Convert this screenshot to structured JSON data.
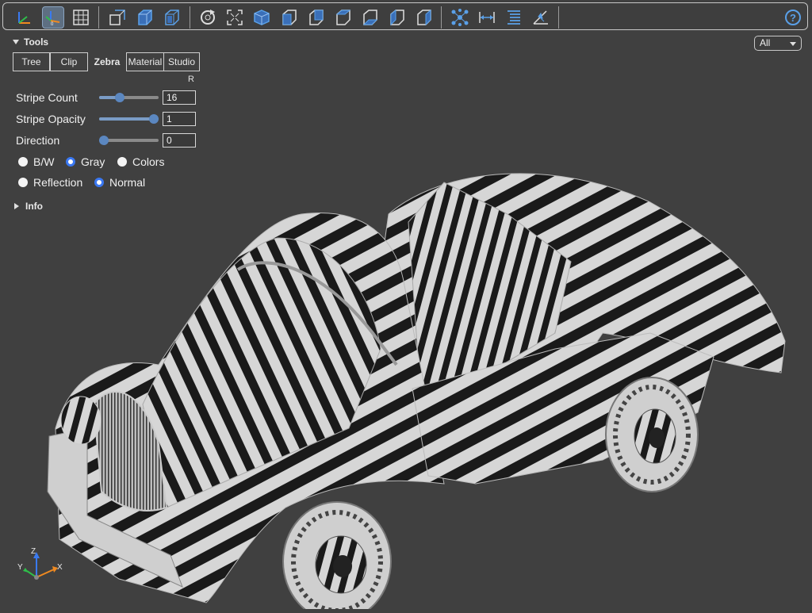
{
  "toolbar": {
    "buttons": [
      {
        "icon": "axes-icon",
        "active": false
      },
      {
        "icon": "axes-origin-icon",
        "active": true
      },
      {
        "icon": "grid-icon",
        "active": false
      },
      {
        "icon": "perspective-icon",
        "active": false
      },
      {
        "icon": "shaded-cube-icon",
        "active": false
      },
      {
        "icon": "wireframe-cube-icon",
        "active": false
      },
      {
        "icon": "reset-view-icon",
        "active": false
      },
      {
        "icon": "fit-view-icon",
        "active": false
      },
      {
        "icon": "iso-view-icon",
        "active": false
      },
      {
        "icon": "front-view-icon",
        "active": false
      },
      {
        "icon": "rear-view-icon",
        "active": false
      },
      {
        "icon": "top-view-icon",
        "active": false
      },
      {
        "icon": "bottom-view-icon",
        "active": false
      },
      {
        "icon": "left-view-icon",
        "active": false
      },
      {
        "icon": "right-view-icon",
        "active": false
      },
      {
        "icon": "explode-icon",
        "active": false
      },
      {
        "icon": "measure-distance-icon",
        "active": false
      },
      {
        "icon": "properties-icon",
        "active": false
      },
      {
        "icon": "angle-measure-icon",
        "active": false
      },
      {
        "icon": "help-icon",
        "active": false
      }
    ]
  },
  "panel": {
    "title": "Tools",
    "view_select": "All",
    "tabs": [
      "Tree",
      "Clip",
      "Zebra",
      "Material",
      "Studio"
    ],
    "active_tab": "Zebra",
    "r_label": "R",
    "controls": {
      "stripe_count": {
        "label": "Stripe Count",
        "value": "16",
        "level": 0.32
      },
      "stripe_opacity": {
        "label": "Stripe Opacity",
        "value": "1",
        "level": 1.0
      },
      "direction": {
        "label": "Direction",
        "value": "0",
        "level": 0.0
      }
    },
    "color_mode": {
      "options": [
        "B/W",
        "Gray",
        "Colors"
      ],
      "selected": "Gray"
    },
    "mapping": {
      "options": [
        "Reflection",
        "Normal"
      ],
      "selected": "Normal"
    },
    "info": "Info"
  },
  "axes": {
    "z": "Z",
    "y": "Y",
    "x": "X"
  },
  "colors": {
    "accent": "#3a78f2",
    "background": "#404040",
    "stripe_dark": "#1a1a1a",
    "stripe_light": "#d6d6d6"
  }
}
